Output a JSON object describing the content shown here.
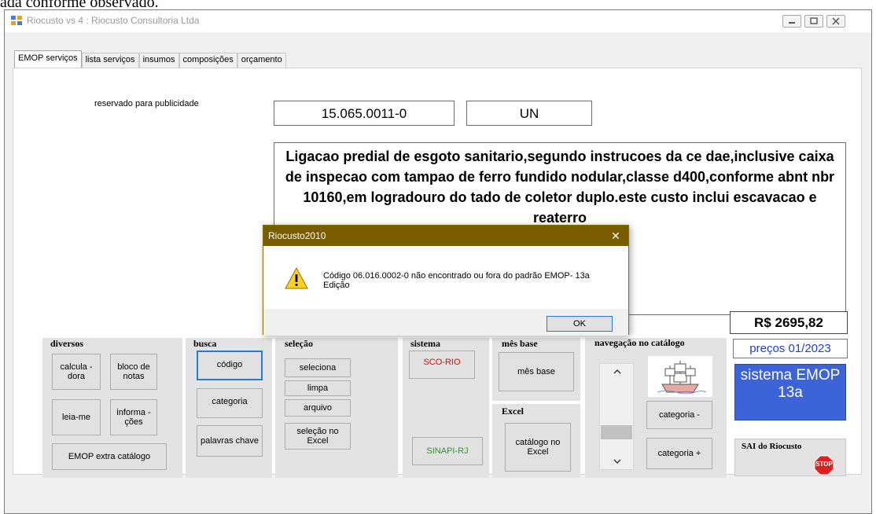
{
  "top_caption": "ada conforme observado.",
  "window": {
    "title": "Riocusto vs 4 : Riocusto Consultoria Ltda"
  },
  "tabs": [
    "EMOP serviços",
    "lista serviços",
    "insumos",
    "composições",
    "orçamento"
  ],
  "main": {
    "advert_text": "reservado para publicidade",
    "code": "15.065.0011-0",
    "unit": "UN",
    "description": "Ligacao predial de esgoto sanitario,segundo instrucoes da ce dae,inclusive caixa de inspecao com tampao de ferro fundido nodular,classe d400,conforme abnt nbr 10160,em logradouro do tado de coletor duplo.este custo inclui escavacao e reaterro",
    "price": "R$ 2695,82",
    "prices_date": "preços 01/2023",
    "system_label": "sistema EMOP 13a"
  },
  "groups": {
    "diversos": {
      "title": "diversos",
      "calculadora": "calcula -dora",
      "bloco": "bloco de notas",
      "leiame": "leia-me",
      "informacoes": "informa - ções",
      "extra": "EMOP extra catálogo"
    },
    "busca": {
      "title": "busca",
      "codigo": "código",
      "categoria": "categoria",
      "palavras": "palavras chave"
    },
    "selecao": {
      "title": "seleção",
      "seleciona": "seleciona",
      "limpa": "limpa",
      "arquivo": "arquivo",
      "excel": "seleção no Excel"
    },
    "sistema": {
      "title": "sistema",
      "sco": "SCO-RIO",
      "sinapi": "SINAPI-RJ"
    },
    "mesbase": {
      "title": "mês base",
      "button": "mês base"
    },
    "excel": {
      "title": "Excel",
      "catalogo": "catálogo no Excel"
    },
    "navegacao": {
      "title": "navegação no catálogo",
      "cat_minus": "categoria -",
      "cat_plus": "categoria +"
    },
    "sai": {
      "title": "SAI do Riocusto",
      "stop": "STOP"
    }
  },
  "dialog": {
    "title": "Riocusto2010",
    "message": "Código 06.016.0002-0 não encontrado ou fora do padrão EMOP- 13a Edição",
    "ok": "OK",
    "close": "✕"
  },
  "colors": {
    "accent_blue": "#2a78d6",
    "system_panel": "#3d63d8",
    "dialog_titlebar": "#7a5c00",
    "sco_text": "#d01010",
    "sinapi_text": "#2a9a2a",
    "stop_red": "#e02020"
  }
}
